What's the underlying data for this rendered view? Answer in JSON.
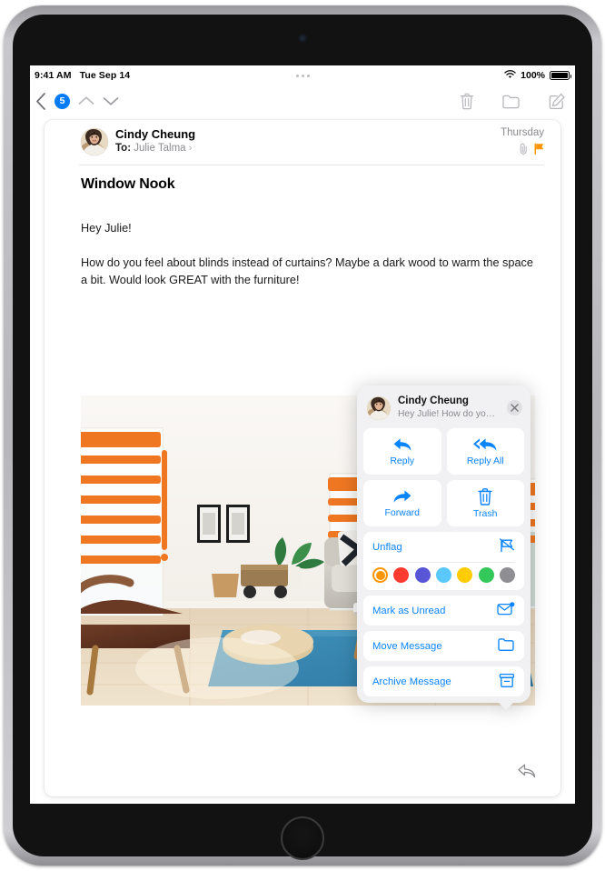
{
  "status_bar": {
    "time": "9:41 AM",
    "date": "Tue Sep 14",
    "wifi_icon": "wifi-icon",
    "battery_percent": "100%",
    "battery_icon": "battery-icon",
    "multitask_dots": "more-dots-icon"
  },
  "toolbar": {
    "back_icon": "chevron-left-icon",
    "unread_badge": "5",
    "previous_icon": "chevron-up-icon",
    "next_icon": "chevron-down-icon",
    "trash_icon": "trash-icon",
    "folder_icon": "folder-icon",
    "compose_icon": "compose-icon"
  },
  "message": {
    "sender": "Cindy Cheung",
    "to_label": "To:",
    "recipient": "Julie Talma",
    "recipient_chevron": "›",
    "date": "Thursday",
    "attachment_icon": "paperclip-icon",
    "flag_icon": "flag-icon",
    "subject": "Window Nook",
    "greeting": "Hey Julie!",
    "paragraph": "How do you feel about blinds instead of curtains? Maybe a dark wood to warm the space a bit. Would look GREAT with the furniture!",
    "photo_alt": "living room with orange blinds, gray sofa, blue rug and pendant lamp",
    "reply_fab_icon": "reply-arrow-icon"
  },
  "popover": {
    "sender": "Cindy Cheung",
    "preview": "Hey Julie! How do you feel ab…",
    "close_icon": "close-icon",
    "actions": [
      {
        "label": "Reply",
        "icon": "reply-icon"
      },
      {
        "label": "Reply All",
        "icon": "reply-all-icon"
      },
      {
        "label": "Forward",
        "icon": "forward-icon"
      },
      {
        "label": "Trash",
        "icon": "trash-icon"
      }
    ],
    "flag_row": {
      "label": "Unflag",
      "icon": "unflag-icon"
    },
    "flag_colors": [
      {
        "name": "orange",
        "hex": "#FF9500",
        "selected": true
      },
      {
        "name": "red",
        "hex": "#FF3B30",
        "selected": false
      },
      {
        "name": "purple",
        "hex": "#5856D6",
        "selected": false
      },
      {
        "name": "blue",
        "hex": "#5AC8FA",
        "selected": false
      },
      {
        "name": "yellow",
        "hex": "#FFCC00",
        "selected": false
      },
      {
        "name": "green",
        "hex": "#34C759",
        "selected": false
      },
      {
        "name": "gray",
        "hex": "#8E8E93",
        "selected": false
      }
    ],
    "rows": [
      {
        "label": "Mark as Unread",
        "icon": "envelope-badge-icon"
      },
      {
        "label": "Move Message",
        "icon": "folder-icon"
      },
      {
        "label": "Archive Message",
        "icon": "archive-icon"
      }
    ]
  },
  "colors": {
    "accent_blue": "#0A84FF",
    "badge_blue": "#067CFD",
    "flag_orange": "#FF9500",
    "toolbar_gray": "#8E8E93"
  }
}
